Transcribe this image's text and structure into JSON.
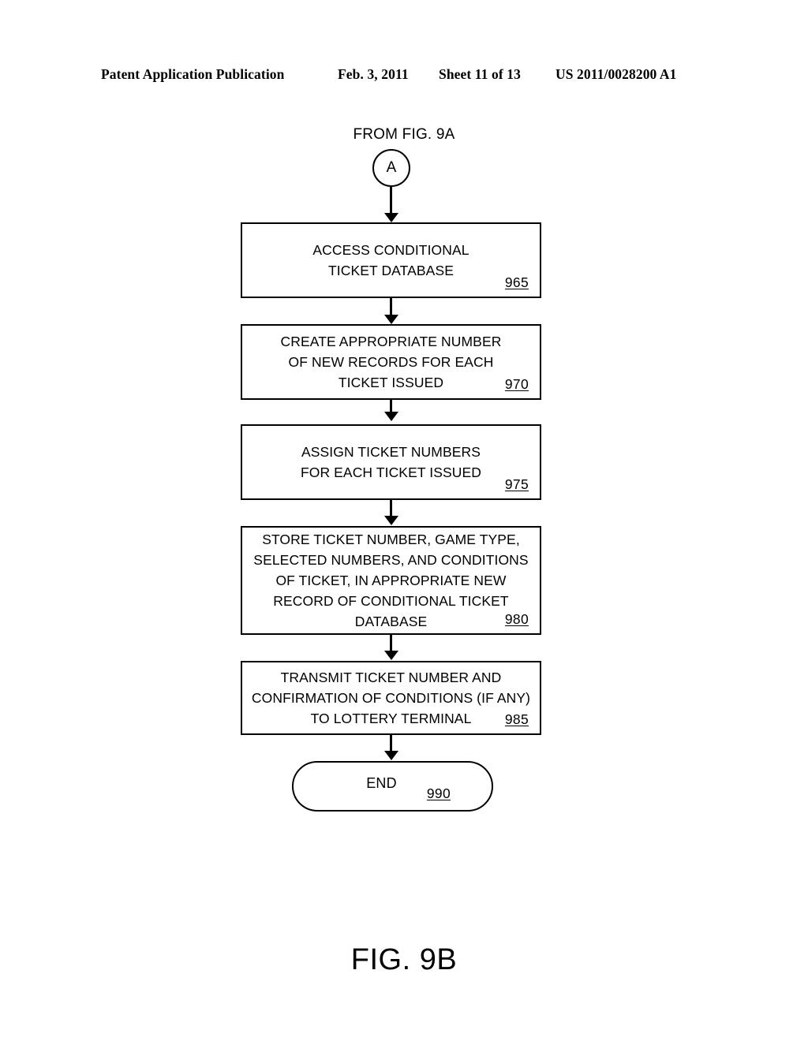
{
  "header": {
    "publication": "Patent Application Publication",
    "date": "Feb. 3, 2011",
    "sheet": "Sheet 11 of 13",
    "patent_number": "US 2011/0028200 A1"
  },
  "figure": {
    "caption": "FIG. 9B",
    "entry_label": "FROM FIG. 9A",
    "connector": "A"
  },
  "flow": {
    "steps": [
      {
        "text": "ACCESS CONDITIONAL\nTICKET DATABASE",
        "ref": "965",
        "shape": "process"
      },
      {
        "text": "CREATE APPROPRIATE NUMBER\nOF NEW RECORDS FOR EACH\nTICKET ISSUED",
        "ref": "970",
        "shape": "process"
      },
      {
        "text": "ASSIGN TICKET NUMBERS\nFOR EACH TICKET ISSUED",
        "ref": "975",
        "shape": "process"
      },
      {
        "text": "STORE TICKET NUMBER, GAME TYPE,\nSELECTED NUMBERS, AND CONDITIONS\nOF TICKET, IN APPROPRIATE NEW\nRECORD OF CONDITIONAL TICKET\nDATABASE",
        "ref": "980",
        "shape": "process"
      },
      {
        "text": "TRANSMIT TICKET NUMBER AND\nCONFIRMATION OF CONDITIONS (IF ANY)\nTO LOTTERY TERMINAL",
        "ref": "985",
        "shape": "process"
      }
    ],
    "terminator": {
      "text": "END",
      "ref": "990",
      "shape": "terminator"
    }
  },
  "colors": {
    "ink": "#000000",
    "paper": "#ffffff"
  }
}
